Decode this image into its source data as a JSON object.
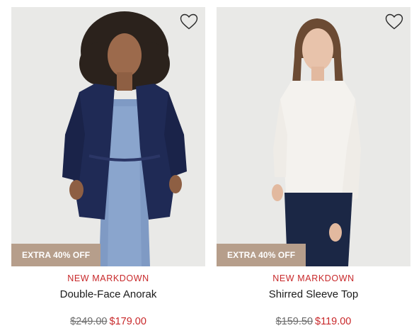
{
  "products": [
    {
      "badge": "EXTRA 40% OFF",
      "tag": "NEW MARKDOWN",
      "name": "Double-Face Anorak",
      "original_price": "$249.00",
      "sale_price": "$179.00",
      "wishlist_icon": "heart-outline-icon"
    },
    {
      "badge": "EXTRA 40% OFF",
      "tag": "NEW MARKDOWN",
      "name": "Shirred Sleeve Top",
      "original_price": "$159.50",
      "sale_price": "$119.00",
      "wishlist_icon": "heart-outline-icon"
    }
  ],
  "colors": {
    "sale_red": "#c8282a",
    "badge_bg": "#b69e8b",
    "photo_bg": "#e8e8e6",
    "strike_gray": "#6b6b6b"
  }
}
